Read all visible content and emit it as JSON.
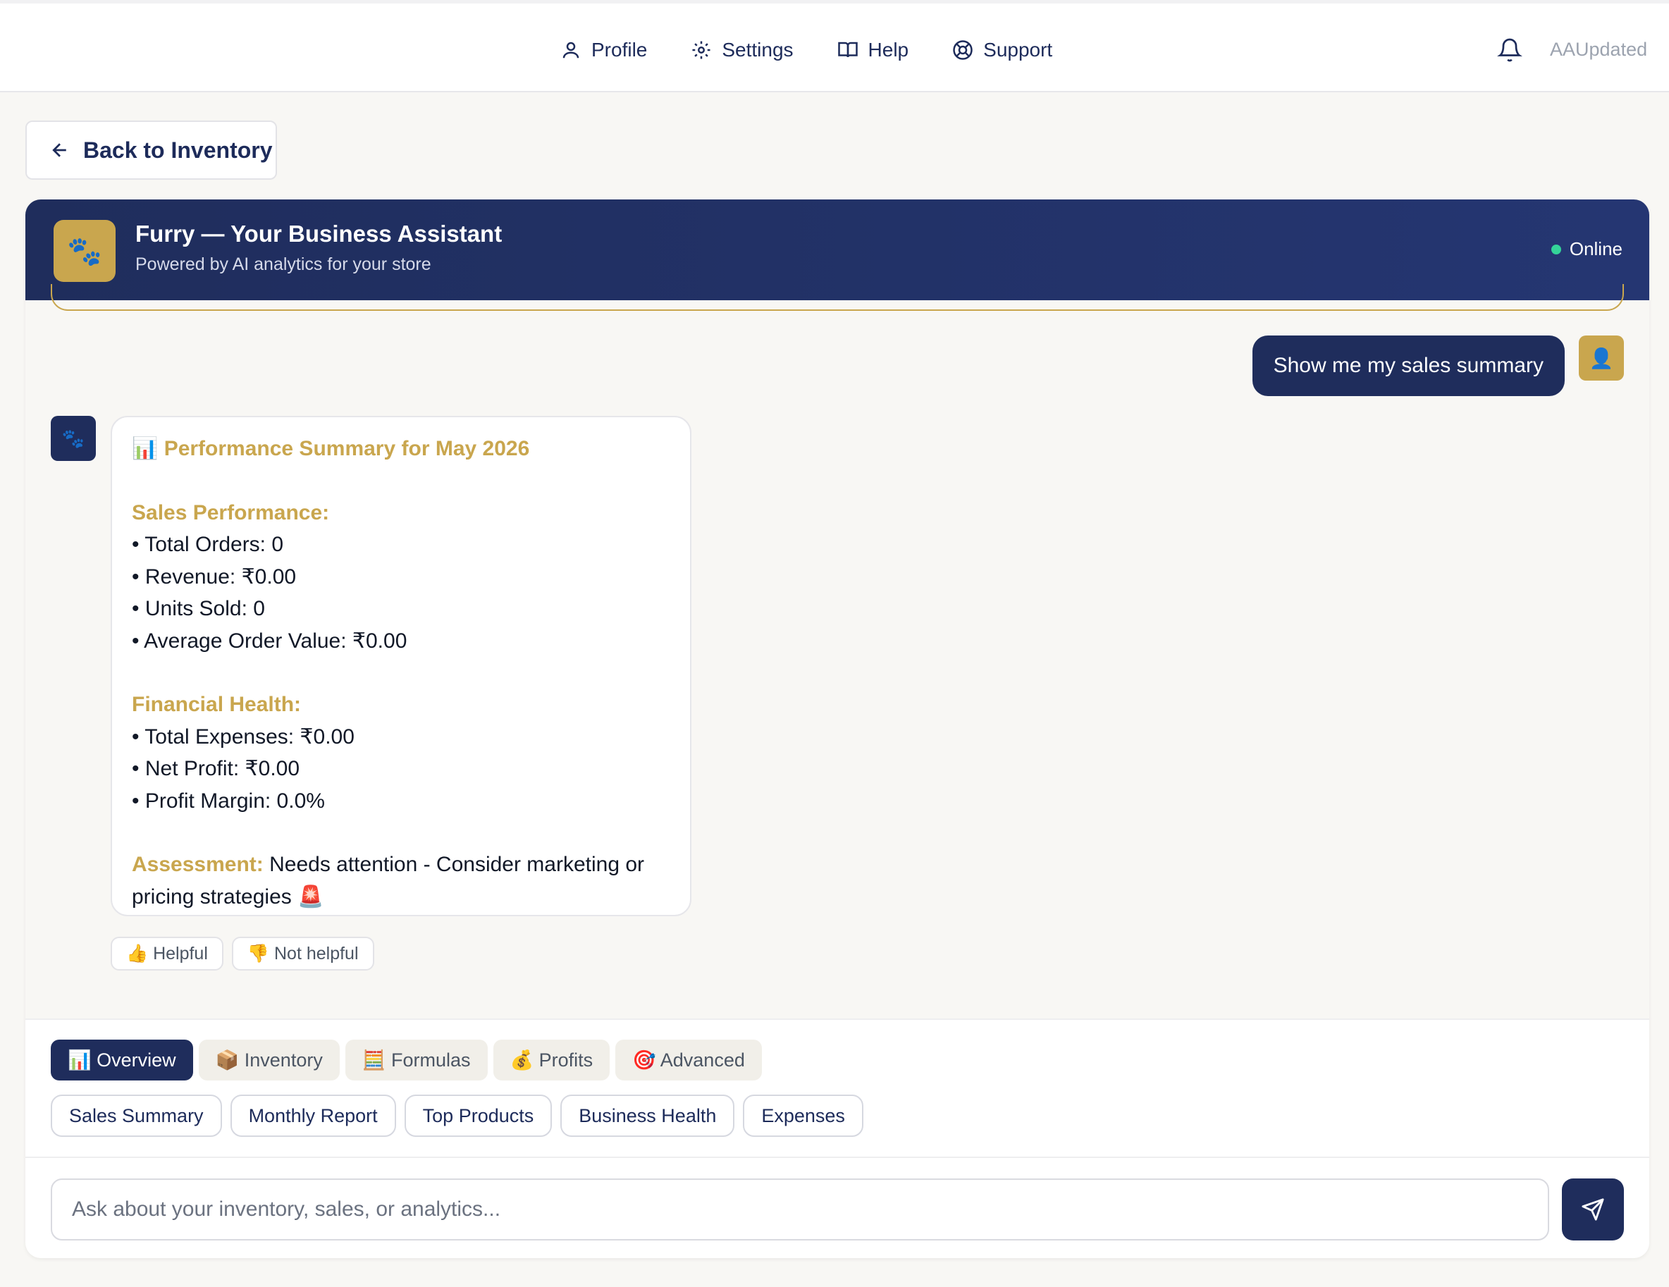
{
  "nav": {
    "items": [
      {
        "label": "Profile",
        "icon": "user-icon"
      },
      {
        "label": "Settings",
        "icon": "gear-icon"
      },
      {
        "label": "Help",
        "icon": "book-icon"
      },
      {
        "label": "Support",
        "icon": "lifebuoy-icon"
      }
    ],
    "bell_icon": "bell-icon",
    "user_name": "AAUpdated"
  },
  "back": {
    "label": "Back to Inventory",
    "icon": "arrow-left-icon"
  },
  "assistant": {
    "logo_glyph": "🐾",
    "title": "Furry — Your Business Assistant",
    "subtitle": "Powered by AI analytics for your store",
    "status": "Online",
    "status_color": "#34d399"
  },
  "messages": {
    "user": {
      "text": "Show me my sales summary",
      "avatar_glyph": "👤"
    },
    "bot": {
      "avatar_glyph": "🐾",
      "title": "📊 Performance Summary for May 2026",
      "sales_heading": "Sales Performance:",
      "sales_lines": [
        "• Total Orders: 0",
        "• Revenue: ₹0.00",
        "• Units Sold: 0",
        "• Average Order Value: ₹0.00"
      ],
      "finance_heading": "Financial Health:",
      "finance_lines": [
        "• Total Expenses: ₹0.00",
        "• Net Profit: ₹0.00",
        "• Profit Margin: 0.0%"
      ],
      "assessment_label": "Assessment:",
      "assessment_text": " Needs attention - Consider marketing or pricing strategies 🚨"
    },
    "feedback": {
      "helpful": "👍 Helpful",
      "not_helpful": "👎 Not helpful"
    }
  },
  "tabs": [
    "📊 Overview",
    "📦 Inventory",
    "🧮 Formulas",
    "💰 Profits",
    "🎯 Advanced"
  ],
  "active_tab": 0,
  "quick_actions": [
    "Sales Summary",
    "Monthly Report",
    "Top Products",
    "Business Health",
    "Expenses"
  ],
  "composer": {
    "placeholder": "Ask about your inventory, sales, or analytics...",
    "value": "",
    "send_icon": "send-icon"
  },
  "colors": {
    "navy": "#1f2d5c",
    "gold": "#c9a64e",
    "background": "#f8f7f4"
  }
}
